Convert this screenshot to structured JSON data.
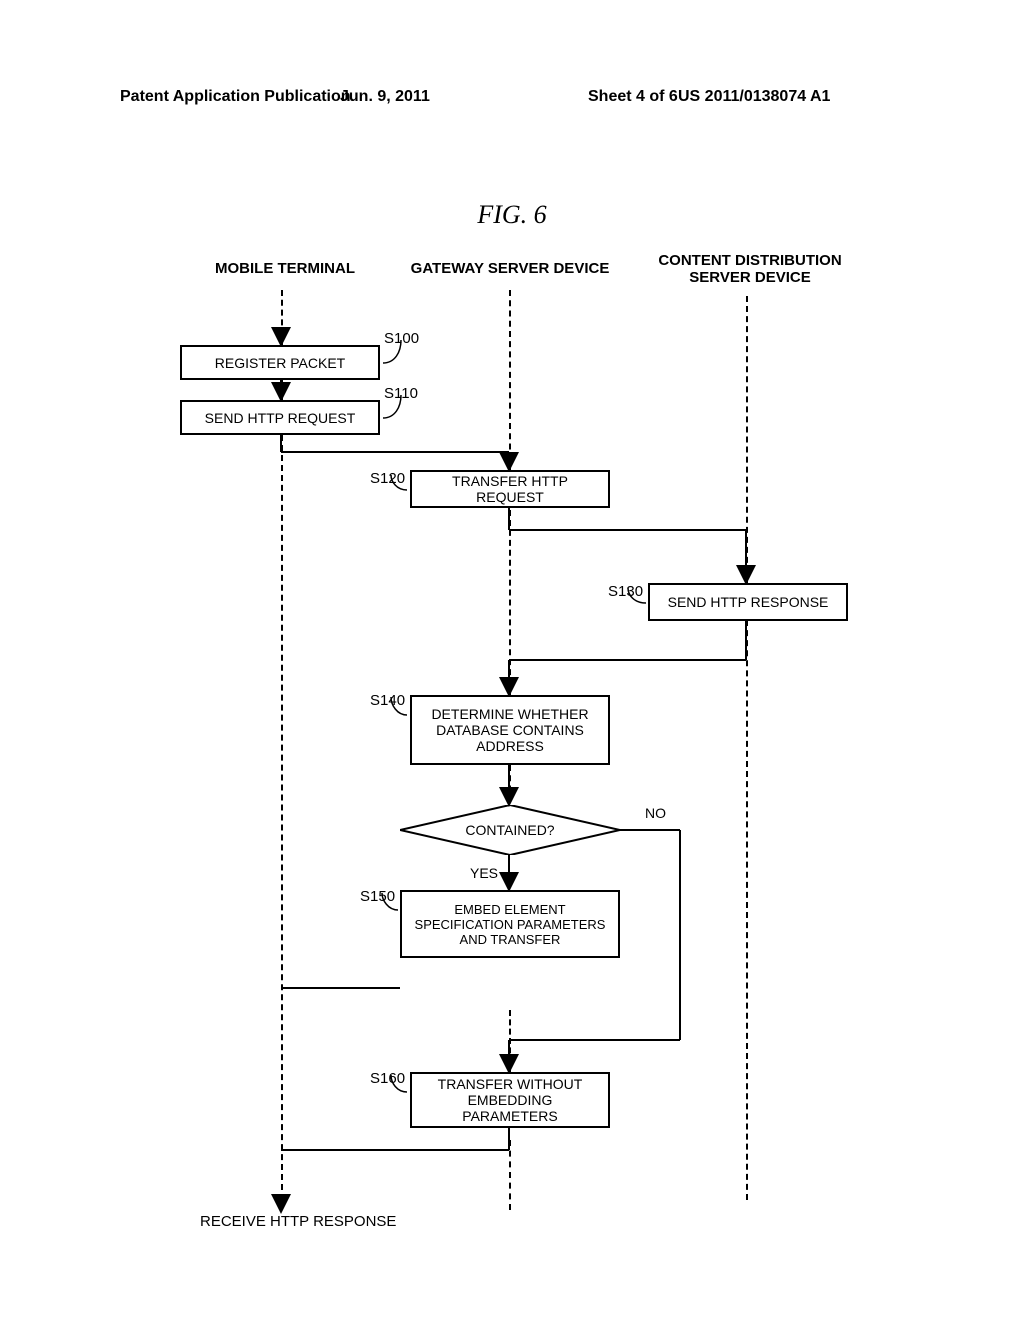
{
  "header": {
    "left": "Patent Application Publication",
    "center": "Jun. 9, 2011",
    "sheet": "Sheet 4 of 6",
    "pubnum": "US 2011/0138074 A1"
  },
  "figure_title": "FIG. 6",
  "lanes": {
    "mobile": "MOBILE TERMINAL",
    "gateway": "GATEWAY SERVER DEVICE",
    "content": "CONTENT DISTRIBUTION SERVER DEVICE"
  },
  "steps": {
    "s100": {
      "label": "S100",
      "text": "REGISTER PACKET"
    },
    "s110": {
      "label": "S110",
      "text": "SEND HTTP REQUEST"
    },
    "s120": {
      "label": "S120",
      "text": "TRANSFER HTTP REQUEST"
    },
    "s130": {
      "label": "S130",
      "text": "SEND HTTP RESPONSE"
    },
    "s140": {
      "label": "S140",
      "text": "DETERMINE WHETHER DATABASE CONTAINS ADDRESS"
    },
    "decision": {
      "text": "CONTAINED?",
      "yes": "YES",
      "no": "NO"
    },
    "s150": {
      "label": "S150",
      "text": "EMBED ELEMENT SPECIFICATION PARAMETERS AND TRANSFER"
    },
    "s160": {
      "label": "S160",
      "text": "TRANSFER WITHOUT EMBEDDING PARAMETERS"
    },
    "receive": "RECEIVE HTTP RESPONSE"
  }
}
